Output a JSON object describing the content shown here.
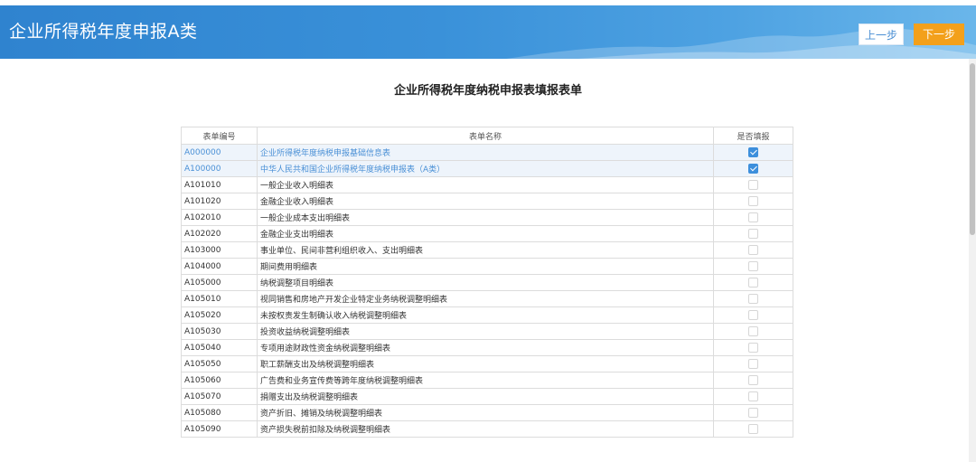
{
  "header": {
    "title": "企业所得税年度申报A类",
    "prev_label": "上一步",
    "next_label": "下一步"
  },
  "form_title": "企业所得税年度纳税申报表填报表单",
  "table": {
    "columns": [
      "表单编号",
      "表单名称",
      "是否填报"
    ],
    "rows": [
      {
        "code": "A000000",
        "name": "企业所得税年度纳税申报基础信息表",
        "checked": true
      },
      {
        "code": "A100000",
        "name": "中华人民共和国企业所得税年度纳税申报表（A类）",
        "checked": true
      },
      {
        "code": "A101010",
        "name": "一般企业收入明细表",
        "checked": false
      },
      {
        "code": "A101020",
        "name": "金融企业收入明细表",
        "checked": false
      },
      {
        "code": "A102010",
        "name": "一般企业成本支出明细表",
        "checked": false
      },
      {
        "code": "A102020",
        "name": "金融企业支出明细表",
        "checked": false
      },
      {
        "code": "A103000",
        "name": "事业单位、民间非营利组织收入、支出明细表",
        "checked": false
      },
      {
        "code": "A104000",
        "name": "期间费用明细表",
        "checked": false
      },
      {
        "code": "A105000",
        "name": "纳税调整项目明细表",
        "checked": false
      },
      {
        "code": "A105010",
        "name": "视同销售和房地产开发企业特定业务纳税调整明细表",
        "checked": false
      },
      {
        "code": "A105020",
        "name": "未按权责发生制确认收入纳税调整明细表",
        "checked": false
      },
      {
        "code": "A105030",
        "name": "投资收益纳税调整明细表",
        "checked": false
      },
      {
        "code": "A105040",
        "name": "专项用途财政性资金纳税调整明细表",
        "checked": false
      },
      {
        "code": "A105050",
        "name": "职工薪酬支出及纳税调整明细表",
        "checked": false
      },
      {
        "code": "A105060",
        "name": "广告费和业务宣传费等跨年度纳税调整明细表",
        "checked": false
      },
      {
        "code": "A105070",
        "name": "捐赠支出及纳税调整明细表",
        "checked": false
      },
      {
        "code": "A105080",
        "name": "资产折旧、摊销及纳税调整明细表",
        "checked": false
      },
      {
        "code": "A105090",
        "name": "资产损失税前扣除及纳税调整明细表",
        "checked": false
      }
    ]
  },
  "colors": {
    "header_blue": "#3a91d9",
    "next_button": "#f3a01b",
    "link_blue": "#4a90d6",
    "checkbox_on": "#3d8fdc"
  },
  "icons": {
    "checkbox_checked": "checkbox-checked-icon",
    "checkbox_unchecked": "checkbox-unchecked-icon"
  }
}
